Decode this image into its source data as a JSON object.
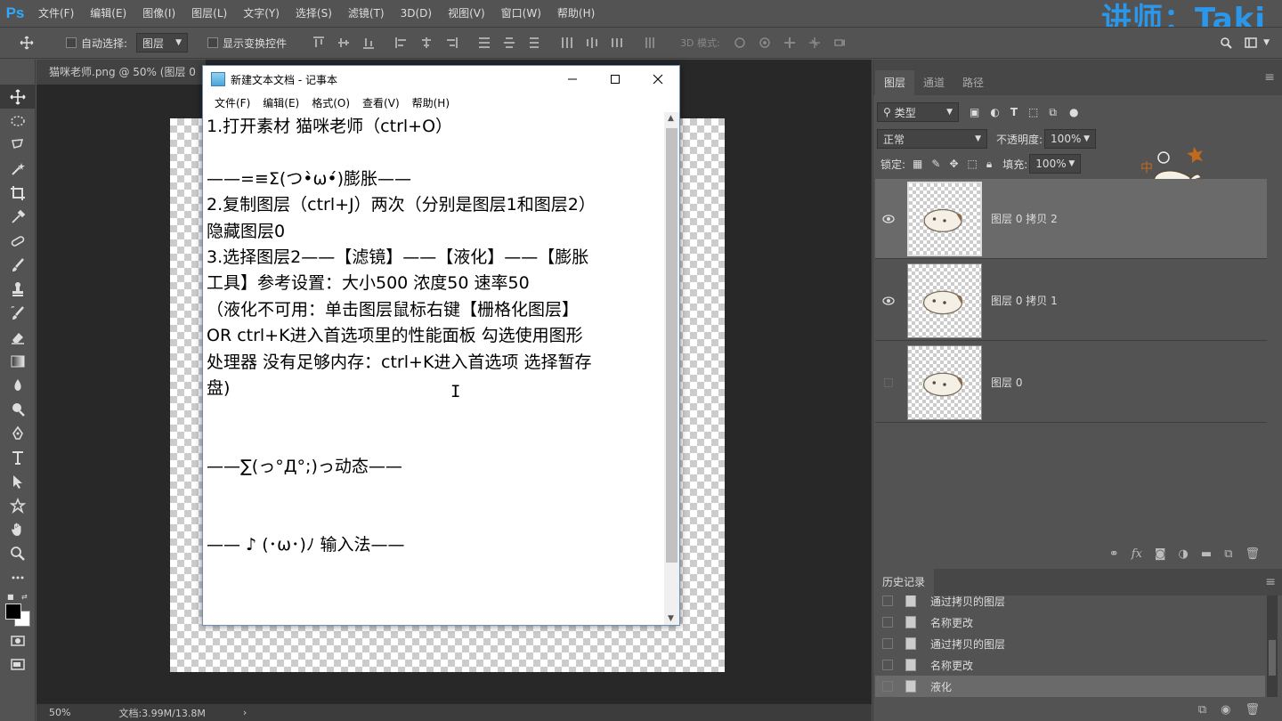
{
  "app": {
    "logo": "Ps"
  },
  "teacher_label": "讲师：Taki",
  "menu": [
    "文件(F)",
    "编辑(E)",
    "图像(I)",
    "图层(L)",
    "文字(Y)",
    "选择(S)",
    "滤镜(T)",
    "3D(D)",
    "视图(V)",
    "窗口(W)",
    "帮助(H)"
  ],
  "options": {
    "auto_select_label": "自动选择:",
    "auto_select_value": "图层",
    "show_transform_label": "显示变换控件",
    "mode_3d_label": "3D 模式:"
  },
  "document": {
    "tab_title": "猫咪老师.png @ 50% (图层 0",
    "zoom": "50%",
    "doc_size": "文档:3.99M/13.8M"
  },
  "notepad": {
    "title": "新建文本文档 - 记事本",
    "menu": [
      "文件(F)",
      "编辑(E)",
      "格式(O)",
      "查看(V)",
      "帮助(H)"
    ],
    "lines": [
      "1.打开素材 猫咪老师（ctrl+O）",
      "",
      "——=≡Σ(つ•̀ω•́)膨胀——",
      "2.复制图层（ctrl+J）两次（分别是图层1和图层2）",
      "隐藏图层0",
      "3.选择图层2——【滤镜】——【液化】——【膨胀",
      "工具】参考设置：大小500 浓度50 速率50",
      "（液化不可用：单击图层鼠标右键【栅格化图层】",
      "OR ctrl+K进入首选项里的性能面板 勾选使用图形",
      "处理器  没有足够内存：ctrl+K进入首选项 选择暂存",
      "盘)",
      "",
      "",
      "——∑(っ°Д°;)っ动态——",
      "",
      "",
      "—— ♪ (･ω･)ﾉ 输入法——"
    ]
  },
  "layers_panel": {
    "tabs": [
      "图层",
      "通道",
      "路径"
    ],
    "filter_label": "类型",
    "blend_mode": "正常",
    "opacity_label": "不透明度:",
    "opacity_value": "100%",
    "lock_label": "锁定:",
    "fill_label": "填充:",
    "fill_value": "100%",
    "layers": [
      {
        "name": "图层 0 拷贝 2",
        "visible": true,
        "selected": true
      },
      {
        "name": "图层 0 拷贝 1",
        "visible": true,
        "selected": false
      },
      {
        "name": "图层 0",
        "visible": false,
        "selected": false
      }
    ]
  },
  "history_panel": {
    "title": "历史记录",
    "items": [
      {
        "label": "通过拷贝的图层",
        "selected": false
      },
      {
        "label": "名称更改",
        "selected": false
      },
      {
        "label": "通过拷贝的图层",
        "selected": false
      },
      {
        "label": "名称更改",
        "selected": false
      },
      {
        "label": "液化",
        "selected": true
      }
    ]
  },
  "colors": {
    "ps_blue": "#31a8ff",
    "teacher_blue": "#2b97ea",
    "panel_bg": "#535353",
    "canvas_bg": "#282828"
  }
}
